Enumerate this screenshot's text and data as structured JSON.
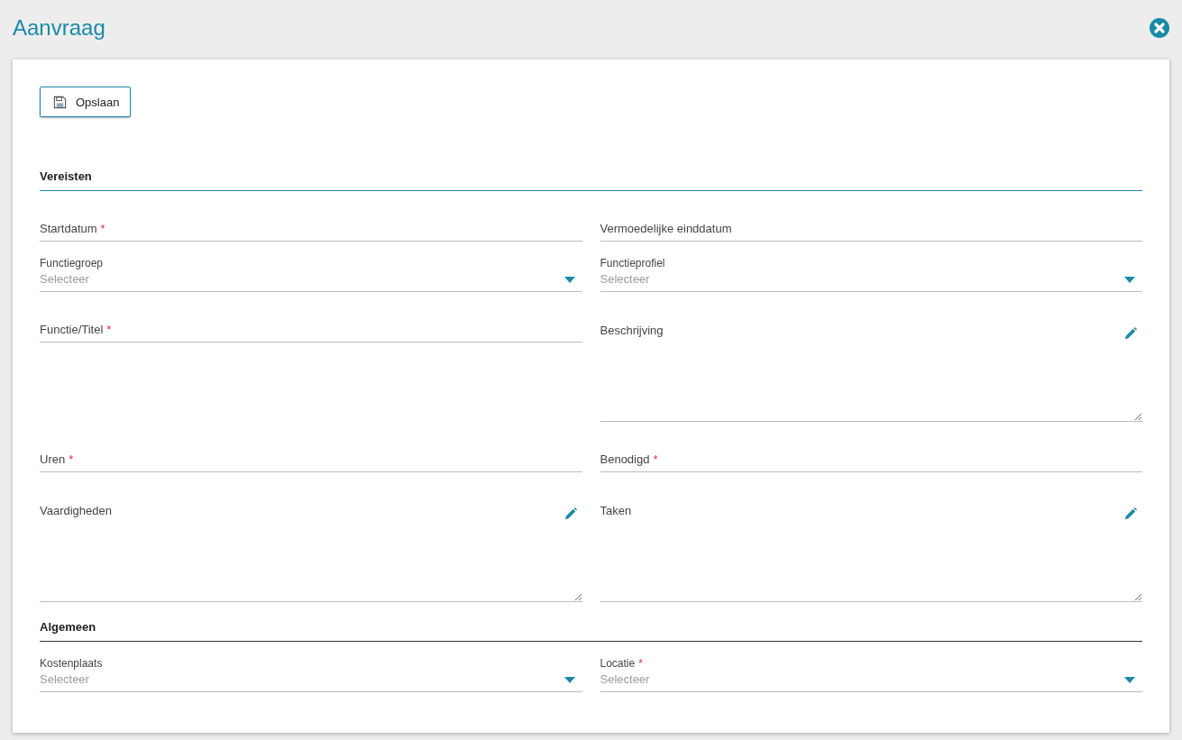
{
  "title": "Aanvraag",
  "save_button": {
    "label": "Opslaan"
  },
  "sections": [
    {
      "title": "Vereisten",
      "kind": "primary",
      "fields": [
        {
          "kind": "text",
          "label": "Startdatum",
          "mark": "*"
        },
        {
          "kind": "text",
          "label": "Vermoedelijke einddatum"
        },
        {
          "kind": "select",
          "label": "Functiegroep",
          "placeholder": "Selecteer"
        },
        {
          "kind": "select",
          "label": "Functieprofiel",
          "placeholder": "Selecteer"
        },
        {
          "kind": "text",
          "label": "Functie/Titel",
          "mark": "*"
        },
        {
          "kind": "textarea",
          "label": "Beschrijving"
        },
        {
          "kind": "text",
          "label": "Uren",
          "mark": "*"
        },
        {
          "kind": "text",
          "label": "Benodigd",
          "mark": "*"
        },
        {
          "kind": "textarea",
          "label": "Vaardigheden"
        },
        {
          "kind": "textarea",
          "label": "Taken"
        }
      ]
    },
    {
      "title": "Algemeen",
      "kind": "secondary",
      "fields": [
        {
          "kind": "select",
          "label": "Kostenplaats",
          "placeholder": "Selecteer"
        },
        {
          "kind": "select",
          "label": "Locatie",
          "mark": "*",
          "placeholder": "Selecteer"
        }
      ]
    }
  ]
}
